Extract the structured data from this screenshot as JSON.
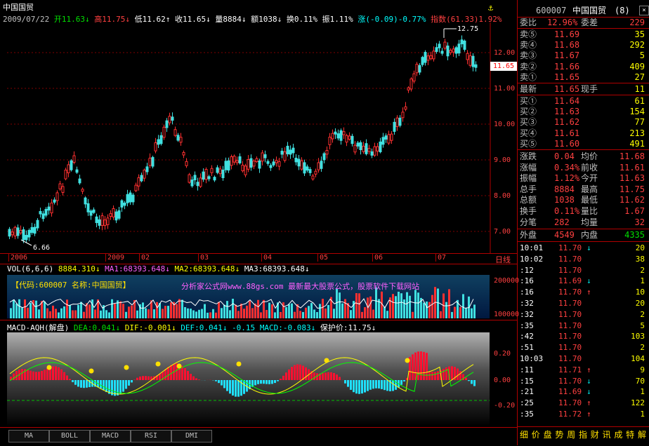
{
  "stock": {
    "name": "中国国贸",
    "code": "600007",
    "count": "(8)"
  },
  "header": {
    "date": "2009/07/22",
    "open_l": "开",
    "open": "11.63",
    "high_l": "高",
    "high": "11.75",
    "low_l": "低",
    "low": "11.62",
    "close_l": "收",
    "close": "11.65",
    "vol_l": "量",
    "vol": "8884",
    "amt_l": "额",
    "amt": "1038",
    "turn_l": "换",
    "turn": "0.11%",
    "amp_l": "振",
    "amp": "1.11%",
    "chg_l": "涨",
    "chg": "(-0.09)-0.77%",
    "idx_l": "指数",
    "idx": "(61.33)1.92%"
  },
  "price_chart": {
    "y_labels": [
      "12.00",
      "11.00",
      "10.00",
      "9.00",
      "8.00",
      "7.00"
    ],
    "current": "11.65",
    "max_mark": "12.75",
    "min_mark": "6.66",
    "x_labels": [
      "2006",
      "2009",
      "02",
      "03",
      "04",
      "05",
      "06",
      "07"
    ],
    "cycle": "日线"
  },
  "vol_panel": {
    "title_l": "VOL(6,6,6)",
    "v1": "8884.310",
    "ma1_l": "MA1:",
    "ma1": "68393.648",
    "ma2_l": "MA2:",
    "ma2": "68393.648",
    "ma3_l": "MA3:",
    "ma3": "68393.648",
    "notice": "【代码:600007 名称:中国国贸】",
    "banner": "分析家公式网www.88gs.com 最新最大股票公式，股票软件下载网站",
    "y_labels": [
      "200000",
      "100000"
    ]
  },
  "macd_panel": {
    "title": "MACD-AQH(解盘)",
    "dea": "DEA:0.041",
    "dif": "DIF:-0.001",
    "def": "DEF:0.041",
    "d2": "-0.15",
    "macd": "MACD:-0.083",
    "guard": "保护价:11.75",
    "y_labels": [
      "0.20",
      "0.00",
      "-0.20"
    ]
  },
  "tabs": [
    "MA",
    "BOLL",
    "MACD",
    "RSI",
    "DMI"
  ],
  "quote": {
    "weibi_l": "委比",
    "weibi": "12.96%",
    "weicha_l": "委差",
    "weicha": "229",
    "asks": [
      {
        "l": "卖⑤",
        "p": "11.69",
        "v": "35"
      },
      {
        "l": "卖④",
        "p": "11.68",
        "v": "292"
      },
      {
        "l": "卖③",
        "p": "11.67",
        "v": "5"
      },
      {
        "l": "卖②",
        "p": "11.66",
        "v": "409"
      },
      {
        "l": "卖①",
        "p": "11.65",
        "v": "27"
      }
    ],
    "last_l": "最新",
    "last": "11.65",
    "now_l": "现手",
    "now": "11",
    "bids": [
      {
        "l": "买①",
        "p": "11.64",
        "v": "61"
      },
      {
        "l": "买②",
        "p": "11.63",
        "v": "154"
      },
      {
        "l": "买③",
        "p": "11.62",
        "v": "77"
      },
      {
        "l": "买④",
        "p": "11.61",
        "v": "213"
      },
      {
        "l": "买⑤",
        "p": "11.60",
        "v": "491"
      }
    ],
    "stats": [
      {
        "l1": "涨跌",
        "v1": "0.04",
        "l2": "均价",
        "v2": "11.68"
      },
      {
        "l1": "涨幅",
        "v1": "0.34%",
        "l2": "前收",
        "v2": "11.61"
      },
      {
        "l1": "振幅",
        "v1": "1.12%",
        "l2": "今开",
        "v2": "11.63"
      },
      {
        "l1": "总手",
        "v1": "8884",
        "l2": "最高",
        "v2": "11.75"
      },
      {
        "l1": "总额",
        "v1": "1038",
        "l2": "最低",
        "v2": "11.62"
      },
      {
        "l1": "换手",
        "v1": "0.11%",
        "l2": "量比",
        "v2": "1.67"
      },
      {
        "l1": "分笔",
        "v1": "282",
        "l2": "均量",
        "v2": "32"
      }
    ],
    "outer_l": "外盘",
    "outer": "4549",
    "inner_l": "内盘",
    "inner": "4335"
  },
  "ticks": [
    {
      "t": "10:01",
      "p": "11.70",
      "a": "↓",
      "v": "20"
    },
    {
      "t": "10:02",
      "p": "11.70",
      "a": "",
      "v": "38"
    },
    {
      "t": ":12",
      "p": "11.70",
      "a": "",
      "v": "2"
    },
    {
      "t": ":16",
      "p": "11.69",
      "a": "↓",
      "v": "1"
    },
    {
      "t": ":16",
      "p": "11.70",
      "a": "↑",
      "v": "10"
    },
    {
      "t": ":32",
      "p": "11.70",
      "a": "",
      "v": "20"
    },
    {
      "t": ":32",
      "p": "11.70",
      "a": "",
      "v": "2"
    },
    {
      "t": ":35",
      "p": "11.70",
      "a": "",
      "v": "5"
    },
    {
      "t": ":42",
      "p": "11.70",
      "a": "",
      "v": "103"
    },
    {
      "t": ":51",
      "p": "11.70",
      "a": "",
      "v": "2"
    },
    {
      "t": "10:03",
      "p": "11.70",
      "a": "",
      "v": "104"
    },
    {
      "t": ":11",
      "p": "11.71",
      "a": "↑",
      "v": "9"
    },
    {
      "t": ":15",
      "p": "11.70",
      "a": "↓",
      "v": "70"
    },
    {
      "t": ":21",
      "p": "11.69",
      "a": "↓",
      "v": "1"
    },
    {
      "t": ":25",
      "p": "11.70",
      "a": "↑",
      "v": "122"
    },
    {
      "t": ":35",
      "p": "11.72",
      "a": "↑",
      "v": "1"
    }
  ],
  "bottom_tabs": [
    "细",
    "价",
    "盘",
    "势",
    "周",
    "指",
    "财",
    "讯",
    "成",
    "特",
    "解"
  ]
}
